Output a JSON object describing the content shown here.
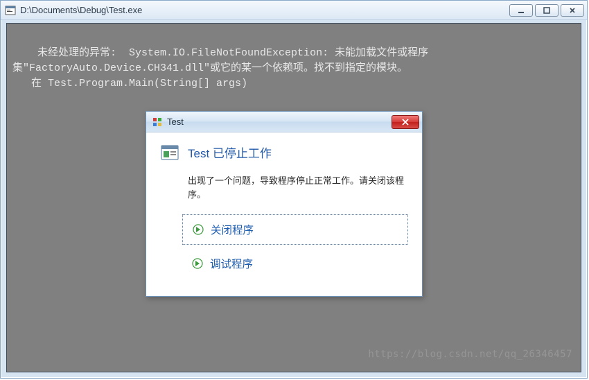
{
  "outer_window": {
    "title": "D:\\Documents\\Debug\\Test.exe"
  },
  "console": {
    "text": "未经处理的异常:  System.IO.FileNotFoundException: 未能加载文件或程序集\"FactoryAuto.Device.CH341.dll\"或它的某一个依赖项。找不到指定的模块。\n   在 Test.Program.Main(String[] args)",
    "watermark": "https://blog.csdn.net/qq_26346457"
  },
  "dialog": {
    "title": "Test",
    "heading": "Test 已停止工作",
    "message": "出现了一个问题，导致程序停止正常工作。请关闭该程序。",
    "action_close": "关闭程序",
    "action_debug": "调试程序"
  }
}
